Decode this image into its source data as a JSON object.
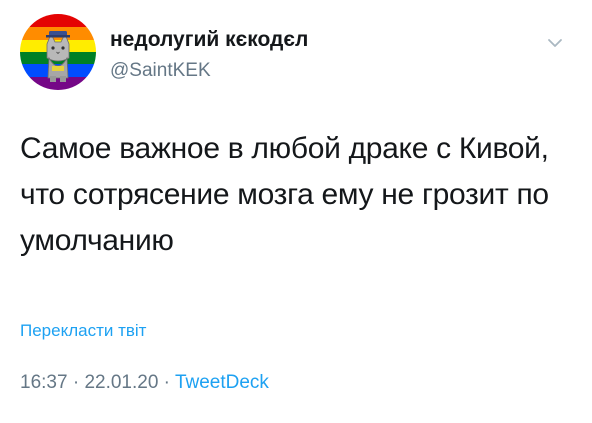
{
  "author": {
    "display_name": "недолугий кєкодєл",
    "handle": "@SaintKEK",
    "avatar_icon": "rainbow-cat-avatar"
  },
  "tweet": {
    "text": "Самое важное в любой драке с Кивой, что сотрясение мозга ему не грозит по умолчанию"
  },
  "translate": {
    "label": "Перекласти твіт"
  },
  "meta": {
    "time": "16:37",
    "separator": " · ",
    "date": "22.01.20",
    "source": "TweetDeck"
  },
  "colors": {
    "link": "#1da1f2",
    "secondary": "#657786",
    "text": "#14171a"
  }
}
